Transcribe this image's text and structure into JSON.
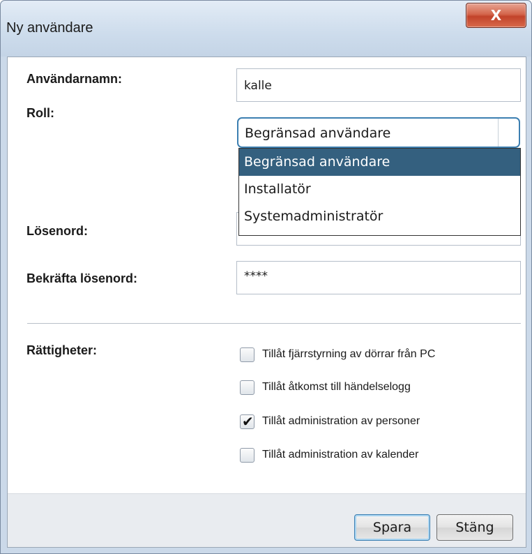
{
  "window": {
    "title": "Ny användare",
    "close_icon_glyph": "X"
  },
  "form": {
    "username_label": "Användarnamn:",
    "username_value": "kalle",
    "role_label": "Roll:",
    "role_selected": "Begränsad användare",
    "role_options": [
      "Begränsad användare",
      "Installatör",
      "Systemadministratör"
    ],
    "password_label": "Lösenord:",
    "confirm_password_label": "Bekräfta lösenord:",
    "confirm_password_value": "****"
  },
  "permissions": {
    "label": "Rättigheter:",
    "items": [
      {
        "label": "Tillåt fjärrstyrning av dörrar från PC",
        "checked": false
      },
      {
        "label": "Tillåt åtkomst till händelselogg",
        "checked": false
      },
      {
        "label": "Tillåt administration av personer",
        "checked": true
      },
      {
        "label": "Tillåt administration av kalender",
        "checked": false
      }
    ]
  },
  "buttons": {
    "save": "Spara",
    "close": "Stäng"
  },
  "colors": {
    "selected_item_bg": "#34607f",
    "focus_border": "#3c7fb1",
    "close_button": "#c2432a"
  }
}
